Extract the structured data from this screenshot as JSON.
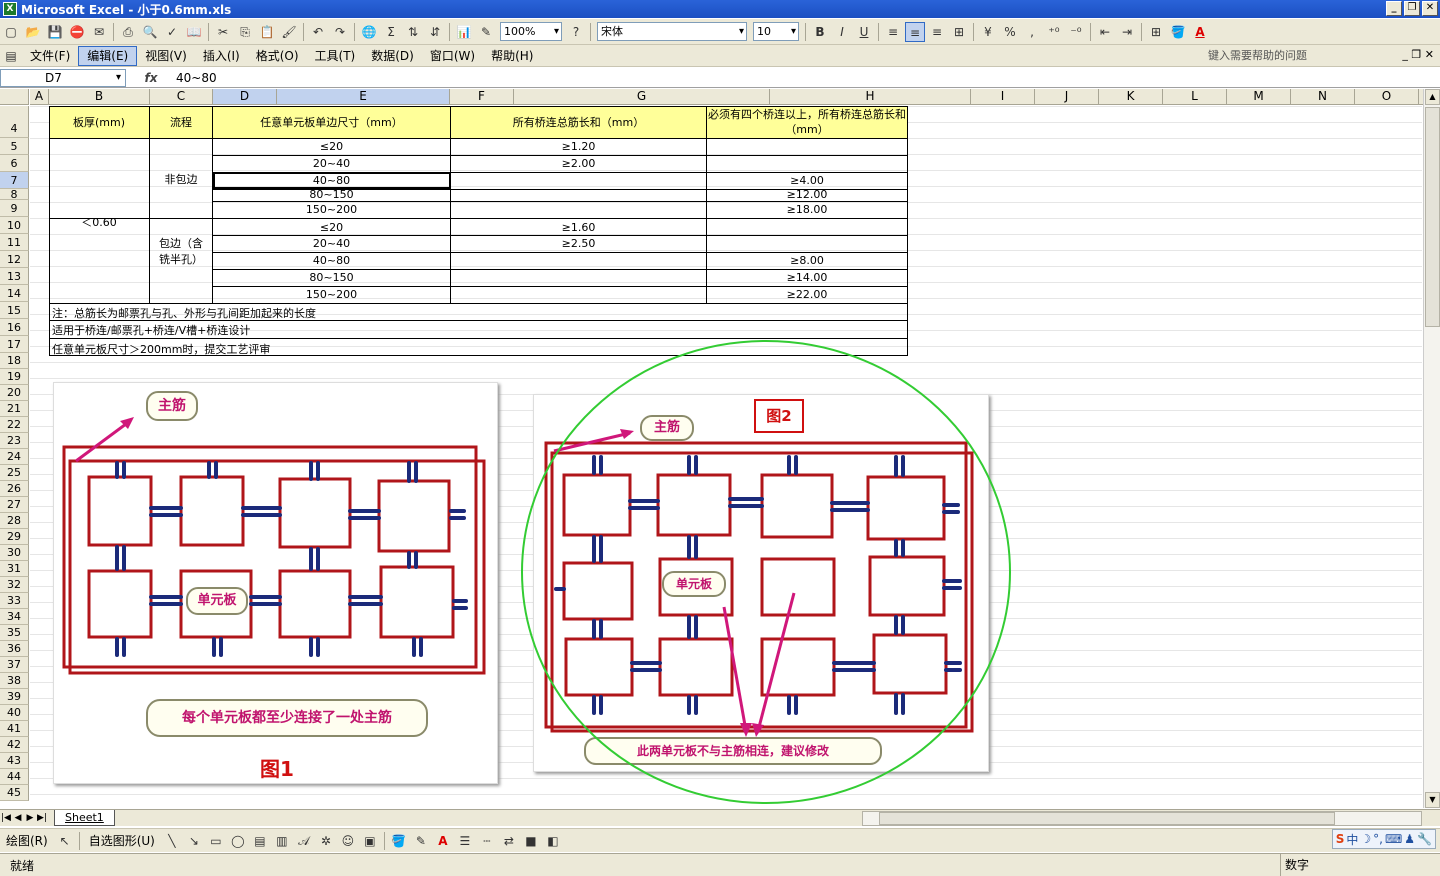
{
  "window": {
    "title": "Microsoft Excel - 小于0.6mm.xls",
    "app_icon": "excel-icon"
  },
  "toolbar": {
    "zoom": "100%",
    "font_name": "宋体",
    "font_size": "10",
    "bold": "B",
    "italic": "I",
    "underline": "U",
    "sum": "Σ",
    "percent": "%",
    "comma": ","
  },
  "menubar": {
    "items": [
      "文件(F)",
      "编辑(E)",
      "视图(V)",
      "插入(I)",
      "格式(O)",
      "工具(T)",
      "数据(D)",
      "窗口(W)",
      "帮助(H)"
    ],
    "active_index": 1,
    "help_placeholder": "键入需要帮助的问题"
  },
  "formula": {
    "cell_ref": "D7",
    "fx": "fx",
    "value": "40~80"
  },
  "columns": [
    "A",
    "B",
    "C",
    "D",
    "E",
    "F",
    "G",
    "H",
    "I",
    "J",
    "K",
    "L",
    "M",
    "N",
    "O",
    "P"
  ],
  "rows": [
    "4",
    "5",
    "6",
    "7",
    "8",
    "9",
    "10",
    "11",
    "12",
    "13",
    "14",
    "15",
    "16",
    "17",
    "18",
    "19",
    "20",
    "21",
    "22",
    "23",
    "24",
    "25",
    "26",
    "27",
    "28",
    "29",
    "30",
    "31",
    "32",
    "33",
    "34",
    "35",
    "36",
    "37",
    "38",
    "39",
    "40",
    "41",
    "42",
    "43",
    "44",
    "45"
  ],
  "table": {
    "headers": {
      "thickness": "板厚(mm)",
      "process": "流程",
      "size": "任意单元板单边尺寸（mm）",
      "total": "所有桥连总筋长和（mm）",
      "four_plus": "必须有四个桥连以上，所有桥连总筋长和（mm）"
    },
    "thickness_value": "＜0.60",
    "group1_label": "非包边",
    "group2_label": "包边（含铣半孔）",
    "group1_rows": [
      {
        "size": "≤20",
        "total": "≥1.20",
        "four": ""
      },
      {
        "size": "20~40",
        "total": "≥2.00",
        "four": ""
      },
      {
        "size": "40~80",
        "total": "",
        "four": "≥4.00"
      },
      {
        "size": "80~150",
        "total": "",
        "four": "≥12.00"
      },
      {
        "size": "150~200",
        "total": "",
        "four": "≥18.00"
      }
    ],
    "group2_rows": [
      {
        "size": "≤20",
        "total": "≥1.60",
        "four": ""
      },
      {
        "size": "20~40",
        "total": "≥2.50",
        "four": ""
      },
      {
        "size": "40~80",
        "total": "",
        "four": "≥8.00"
      },
      {
        "size": "80~150",
        "total": "",
        "four": "≥14.00"
      },
      {
        "size": "150~200",
        "total": "",
        "four": "≥22.00"
      }
    ],
    "notes": [
      "注：总筋长为邮票孔与孔、外形与孔间距加起来的长度",
      "适用于桥连/邮票孔+桥连/V槽+桥连设计",
      "任意单元板尺寸＞200mm时，提交工艺评审"
    ]
  },
  "figures": {
    "fig1": {
      "main_bar": "主筋",
      "unit_board": "单元板",
      "caption": "每个单元板都至少连接了一处主筋",
      "label": "图1"
    },
    "fig2": {
      "main_bar": "主筋",
      "unit_board": "单元板",
      "caption": "此两单元板不与主筋相连，建议修改",
      "label": "图2"
    },
    "colors": {
      "frame": "#b0151a",
      "bridge": "#1b2a7a",
      "arrow": "#d0177a",
      "circle": "#33cc33",
      "label_text": "#c0146e"
    }
  },
  "sheet_tab": "Sheet1",
  "drawbar": {
    "draw": "绘图(R)",
    "autoshapes": "自选图形(U)"
  },
  "status": {
    "left": "就绪",
    "right": "数字"
  },
  "ime": [
    "S",
    "中",
    "☽",
    "°,",
    "⌨",
    "♟",
    "🔧"
  ]
}
